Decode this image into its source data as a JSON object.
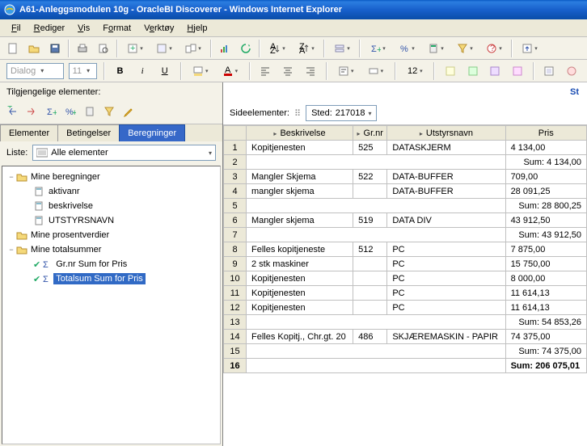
{
  "title": "A61-Anleggsmodulen 10g - OracleBI Discoverer - Windows Internet Explorer",
  "menu": {
    "fil": "Fil",
    "rediger": "Rediger",
    "vis": "Vis",
    "format": "Format",
    "verktoy": "Verktøy",
    "hjelp": "Hjelp"
  },
  "font": {
    "name": "Dialog",
    "size": "11"
  },
  "sidebar": {
    "title": "Tilgjengelige elementer:",
    "tabs": {
      "el": "Elementer",
      "bet": "Betingelser",
      "ber": "Beregninger"
    },
    "liste_label": "Liste:",
    "liste_value": "Alle elementer",
    "tree": {
      "mine_ber": "Mine beregninger",
      "aktivanr": "aktivanr",
      "beskrivelse": "beskrivelse",
      "utstyrsnavn": "UTSTYRSNAVN",
      "mine_pros": "Mine prosentverdier",
      "mine_tot": "Mine totalsummer",
      "grnr_sum": "Gr.nr Sum for Pris",
      "totalsum": "Totalsum Sum for Pris"
    }
  },
  "content": {
    "slink": "St",
    "sideel_label": "Sideelementer:",
    "sted_label": "Sted:",
    "sted_value": "217018",
    "headers": {
      "besk": "Beskrivelse",
      "grnr": "Gr.nr",
      "utst": "Utstyrsnavn",
      "pris": "Pris"
    },
    "rows": [
      {
        "n": "1",
        "b": "Kopitjenesten",
        "g": "525",
        "u": "DATASKJERM",
        "p": "4 134,00"
      },
      {
        "n": "2",
        "sum": "Sum: 4 134,00"
      },
      {
        "n": "3",
        "b": "Mangler Skjema",
        "g": "522",
        "u": "DATA-BUFFER",
        "p": "709,00"
      },
      {
        "n": "4",
        "b": "mangler skjema",
        "g": "",
        "u": "DATA-BUFFER",
        "p": "28 091,25"
      },
      {
        "n": "5",
        "sum": "Sum: 28 800,25"
      },
      {
        "n": "6",
        "b": "Mangler skjema",
        "g": "519",
        "u": "DATA DIV",
        "p": "43 912,50"
      },
      {
        "n": "7",
        "sum": "Sum: 43 912,50"
      },
      {
        "n": "8",
        "b": "Felles kopitjeneste",
        "g": "512",
        "u": "PC",
        "p": "7 875,00"
      },
      {
        "n": "9",
        "b": "2 stk maskiner",
        "g": "",
        "u": "PC",
        "p": "15 750,00"
      },
      {
        "n": "10",
        "b": "Kopitjenesten",
        "g": "",
        "u": "PC",
        "p": "8 000,00"
      },
      {
        "n": "11",
        "b": "Kopitjenesten",
        "g": "",
        "u": "PC",
        "p": "11 614,13"
      },
      {
        "n": "12",
        "b": "Kopitjenesten",
        "g": "",
        "u": "PC",
        "p": "11 614,13"
      },
      {
        "n": "13",
        "sum": "Sum: 54 853,26"
      },
      {
        "n": "14",
        "b": "Felles Kopitj., Chr.gt. 20",
        "g": "486",
        "u": "SKJÆREMASKIN - PAPIR",
        "p": "74 375,00"
      },
      {
        "n": "15",
        "sum": "Sum: 74 375,00"
      },
      {
        "n": "16",
        "total": "Sum: 206 075,01"
      }
    ]
  }
}
